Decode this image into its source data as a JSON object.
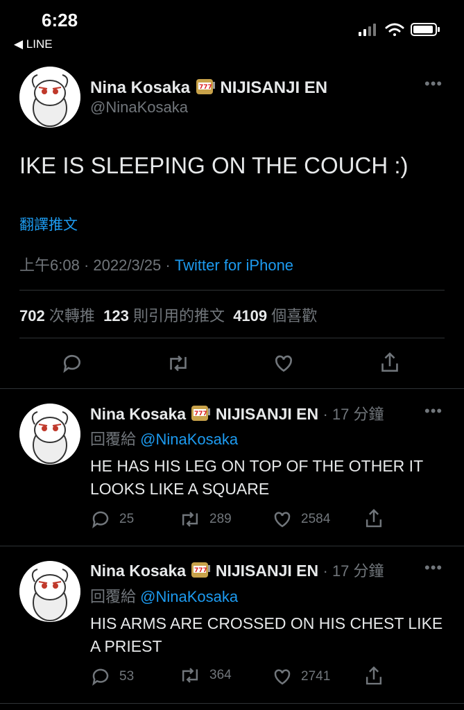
{
  "status_bar": {
    "time": "6:28",
    "back_label": "◀ LINE"
  },
  "tweet": {
    "author_name": "Nina Kosaka",
    "author_suffix": "NIJISANJI EN",
    "handle": "@NinaKosaka",
    "text": "IKE IS SLEEPING ON THE COUCH :)",
    "translate_label": "翻譯推文",
    "time": "上午6:08",
    "date": "2022/3/25",
    "source": "Twitter for iPhone",
    "retweets": "702",
    "retweets_label": "次轉推",
    "quotes": "123",
    "quotes_label": "則引用的推文",
    "likes": "4109",
    "likes_label": "個喜歡"
  },
  "replies": [
    {
      "author_name": "Nina Kosaka",
      "author_suffix": "NIJISANJI EN",
      "time_ago": "· 17 分鐘",
      "reply_to_label": "回覆給",
      "reply_to_handle": "@NinaKosaka",
      "text": "HE HAS HIS LEG ON TOP OF THE OTHER IT LOOKS LIKE A SQUARE",
      "reply_count": "25",
      "retweet_count": "289",
      "like_count": "2584"
    },
    {
      "author_name": "Nina Kosaka",
      "author_suffix": "NIJISANJI EN",
      "time_ago": "· 17 分鐘",
      "reply_to_label": "回覆給",
      "reply_to_handle": "@NinaKosaka",
      "text": "HIS ARMS ARE CROSSED ON HIS CHEST LIKE A PRIEST",
      "reply_count": "53",
      "retweet_count": "364",
      "like_count": "2741"
    }
  ],
  "icons": {
    "more": "more-icon",
    "reply": "reply-icon",
    "retweet": "retweet-icon",
    "like": "like-icon",
    "share": "share-icon",
    "slot": "slot-machine-icon"
  },
  "colors": {
    "background": "#000000",
    "accent": "#1d9bf0",
    "muted": "#71767b",
    "text": "#e7e9ea"
  }
}
